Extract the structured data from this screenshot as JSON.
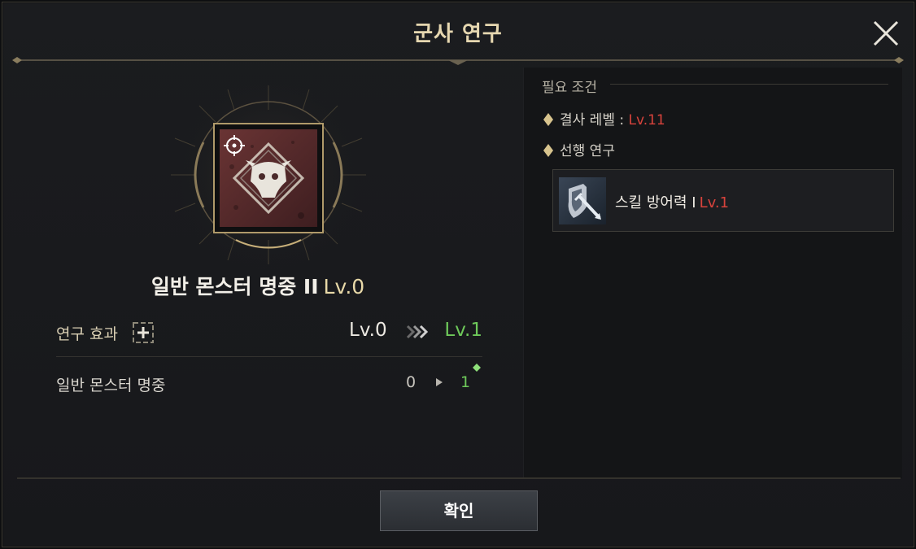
{
  "dialog": {
    "title": "군사 연구"
  },
  "skill": {
    "name": "일반 몬스터 명중 II",
    "level": "Lv.0"
  },
  "effect": {
    "label": "연구 효과",
    "from_level": "Lv.0",
    "to_level": "Lv.1"
  },
  "stat": {
    "label": "일반 몬스터 명중",
    "from": "0",
    "to": "1"
  },
  "requirements": {
    "header": "필요 조건",
    "guild_level_label": "결사 레벨 : ",
    "guild_level_value": "Lv.11",
    "prereq_label": "선행 연구",
    "prereq_skill_name": "스킬 방어력 I",
    "prereq_skill_level": "Lv.1"
  },
  "footer": {
    "confirm_label": "확인"
  },
  "colors": {
    "accent_gold": "#e6d7b0",
    "upgrade_green": "#6ec95a",
    "requirement_red": "#d8433c"
  },
  "icons": {
    "close": "close-icon",
    "emblem": "monster-skull-emblem-icon",
    "crosshair": "crosshair-icon",
    "plus": "plus-icon",
    "arrows": "double-chevron-right-icon",
    "shield": "shield-sword-icon"
  }
}
